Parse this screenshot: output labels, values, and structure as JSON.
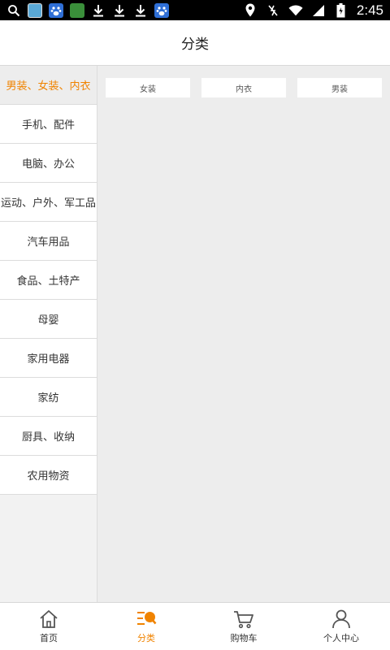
{
  "status_bar": {
    "time": "2:45",
    "left_icons": [
      "search-icon",
      "app-icon",
      "baidu-icon",
      "map-app-icon",
      "download-icon",
      "download-icon",
      "download-icon",
      "baidu-icon"
    ],
    "right_icons": [
      "location-icon",
      "vibrate-off-icon",
      "wifi-icon",
      "signal-icon",
      "battery-icon"
    ]
  },
  "header": {
    "title": "分类"
  },
  "sidebar": {
    "items": [
      {
        "label": "男装、女装、内衣",
        "active": true
      },
      {
        "label": "手机、配件"
      },
      {
        "label": "电脑、办公"
      },
      {
        "label": "运动、户外、军工品"
      },
      {
        "label": "汽车用品"
      },
      {
        "label": "食品、土特产"
      },
      {
        "label": "母婴"
      },
      {
        "label": "家用电器"
      },
      {
        "label": "家纺"
      },
      {
        "label": "厨具、收纳"
      },
      {
        "label": "农用物资"
      }
    ]
  },
  "content": {
    "subcategories": [
      "女装",
      "内衣",
      "男装"
    ]
  },
  "tabbar": {
    "items": [
      {
        "label": "首页",
        "icon": "home-icon"
      },
      {
        "label": "分类",
        "icon": "category-icon",
        "active": true
      },
      {
        "label": "购物车",
        "icon": "cart-icon"
      },
      {
        "label": "个人中心",
        "icon": "user-icon"
      }
    ]
  },
  "colors": {
    "accent": "#f08300",
    "background": "#ededed",
    "statusbar": "#000000"
  }
}
